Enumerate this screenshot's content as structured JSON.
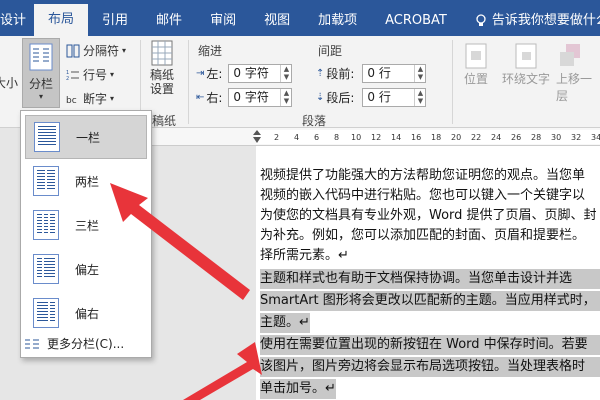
{
  "tabs": [
    "设计",
    "布局",
    "引用",
    "邮件",
    "审阅",
    "视图",
    "加载项",
    "ACROBAT"
  ],
  "active_tab": "布局",
  "tell_me": "告诉我你想要做什么",
  "ribbon": {
    "size_label": "大小",
    "columns_label": "分栏",
    "breaks_label": "分隔符",
    "line_numbers_label": "行号",
    "hyphenation_label": "断字",
    "manuscript_label": "稿纸\n设置",
    "manuscript_group": "稿纸",
    "indent_title": "缩进",
    "indent_left_label": "左:",
    "indent_left_value": "0 字符",
    "indent_right_label": "右:",
    "indent_right_value": "0 字符",
    "spacing_title": "间距",
    "spacing_before_label": "段前:",
    "spacing_before_value": "0 行",
    "spacing_after_label": "段后:",
    "spacing_after_value": "0 行",
    "paragraph_group": "段落",
    "position_label": "位置",
    "wrap_label": "环绕文字",
    "bring_forward_label": "上移一层"
  },
  "columns_menu": {
    "items": [
      "一栏",
      "两栏",
      "三栏",
      "偏左",
      "偏右"
    ],
    "more": "更多分栏(C)..."
  },
  "document": {
    "lines": [
      "视频提供了功能强大的方法帮助您证明您的观点。当您单",
      "视频的嵌入代码中进行粘贴。您也可以键入一个关键字以",
      "为使您的文档具有专业外观，Word 提供了页眉、页脚、封",
      "为补充。例如，您可以添加匹配的封面、页眉和提要栏。",
      "择所需元素。↵",
      "主题和样式也有助于文档保持协调。当您单击设计并选",
      "SmartArt 图形将会更改以匹配新的主题。当应用样式时，",
      "主题。↵",
      "使用在需要位置出现的新按钮在 Word 中保存时间。若要",
      "该图片，图片旁边将会显示布局选项按钮。当处理表格时",
      "单击加号。↵"
    ]
  },
  "colors": {
    "brand": "#2b579a",
    "arrow": "#e8343a"
  }
}
